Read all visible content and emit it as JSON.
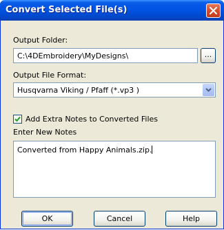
{
  "dialog": {
    "title": "Convert Selected File(s)"
  },
  "output_folder": {
    "label": "Output Folder:",
    "value": "C:\\4DEmbroidery\\MyDesigns\\",
    "browse_label": "..."
  },
  "output_format": {
    "label": "Output File Format:",
    "selected": "Husqvarna Viking / Pfaff (*.vp3 )"
  },
  "extra_notes": {
    "checkbox_label": "Add Extra Notes to Converted Files",
    "checked": true,
    "notes_label": "Enter New Notes",
    "notes_value": "Converted from Happy Animals.zip."
  },
  "buttons": {
    "ok": "OK",
    "cancel": "Cancel",
    "help": "Help"
  },
  "icons": {
    "close": "close-icon",
    "dropdown": "chevron-down-icon",
    "check": "check-icon"
  },
  "colors": {
    "titlebar": "#0054e3",
    "close_button": "#d44d2e",
    "dialog_bg": "#ece9d8",
    "field_border": "#7f9db9"
  }
}
